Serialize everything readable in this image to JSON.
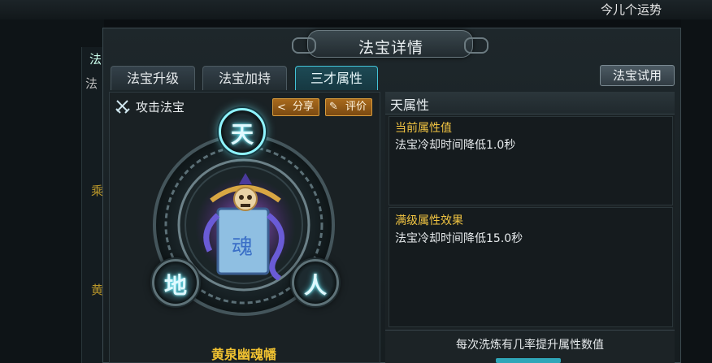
{
  "background": {
    "top_text": "今儿个运势",
    "left_labels": [
      "法",
      "法",
      "乘",
      "黄"
    ]
  },
  "window": {
    "title": "法宝详情",
    "tabs": [
      {
        "label": "法宝升级",
        "active": false
      },
      {
        "label": "法宝加持",
        "active": false
      },
      {
        "label": "三才属性",
        "active": true
      }
    ],
    "try_button": "法宝试用"
  },
  "left": {
    "attack_label": "攻击法宝",
    "share_button": "分享",
    "rate_button": "评价",
    "nodes": {
      "heaven": "天",
      "earth": "地",
      "human": "人"
    },
    "artifact_name": "黄泉幽魂幡"
  },
  "right": {
    "section_title": "天属性",
    "current_label": "当前属性值",
    "current_value": "法宝冷却时间降低1.0秒",
    "max_label": "满级属性效果",
    "max_value": "法宝冷却时间降低15.0秒",
    "refine_text": "每次洗炼有几率提升属性数值"
  },
  "colors": {
    "accent": "#43c2d6",
    "gold": "#f2c542",
    "button_orange": "#a96a1c"
  }
}
